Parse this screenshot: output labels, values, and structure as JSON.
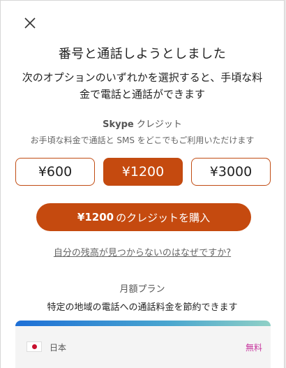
{
  "dialog": {
    "title": "番号と通話しようとしました",
    "subtitle": "次のオプションのいずれかを選択すると、手頃な料金で電話と通話ができます"
  },
  "credit": {
    "brand": "Skype",
    "label": "クレジット",
    "description": "お手頃な料金で通話と SMS をどこでもご利用いただけます",
    "amounts": [
      "¥600",
      "¥1200",
      "¥3000"
    ],
    "selected": "¥1200",
    "buy_amount": "¥1200",
    "buy_text": "のクレジットを購入",
    "balance_link": "自分の残高が見つからないのはなぜですか?"
  },
  "plan": {
    "heading": "月額プラン",
    "description": "特定の地域の電話への通話料金を節約できます",
    "country": "日本",
    "badge": "無料"
  },
  "colors": {
    "accent": "#c54a0f",
    "badge": "#c83aa0"
  },
  "icons": {
    "close": "close-icon",
    "flag": "japan-flag-icon"
  }
}
